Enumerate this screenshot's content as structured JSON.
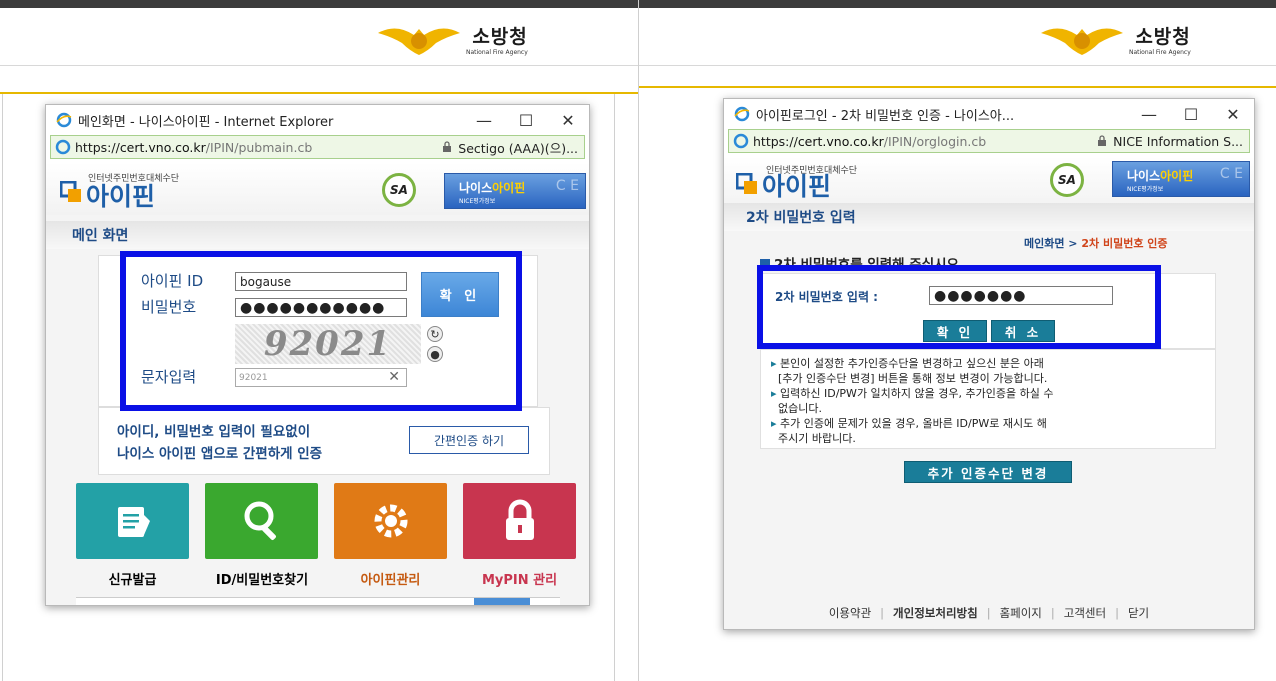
{
  "agency": {
    "name": "소방청",
    "en": "National Fire Agency"
  },
  "left": {
    "window_title": "메인화면 - 나이스아이핀 - Internet Explorer",
    "url_proto": "https://",
    "url_host": "cert.vno.co.kr",
    "url_path": "/IPIN/pubmain.cb",
    "cert": "Sectigo (AAA)(으)...",
    "ipin_small": "인터넷주민번호대체수단",
    "ipin_logo": "아이핀",
    "sa_badge": "SA",
    "nice_box": {
      "a": "나이스",
      "b": "아이핀",
      "sub": "NICE평가정보",
      "ce": "C E"
    },
    "section_title": "메인 화면",
    "id_label": "아이핀 ID",
    "id_value": "bogause",
    "pw_label": "비밀번호",
    "pw_value": "●●●●●●●●●●●",
    "confirm": "확 인",
    "captcha_text": "92021",
    "captcha_label": "문자입력",
    "captcha_value": "92021",
    "promo_line1": "아이디, 비밀번호 입력이 필요없이",
    "promo_line2": "나이스 아이핀 앱으로 간편하게 인증",
    "promo_button": "간편인증 하기",
    "tiles": [
      {
        "label": "신규발급",
        "color": "#23a1a6",
        "label_color": "#1e4b86",
        "icon": "document-icon"
      },
      {
        "label": "ID/비밀번호찾기",
        "color": "#3aa82f",
        "label_color": "#1e4b86",
        "icon": "search-icon"
      },
      {
        "label": "아이핀관리",
        "color": "#e07a16",
        "label_color": "#c55a11",
        "icon": "gear-icon"
      },
      {
        "label": "MyPIN 관리",
        "color": "#c8354f",
        "label_color": "#c8354f",
        "icon": "lock-icon"
      }
    ]
  },
  "right": {
    "window_title": "아이핀로그인 - 2차 비밀번호 인증 - 나이스아...",
    "url_proto": "https://",
    "url_host": "cert.vno.co.kr",
    "url_path": "/IPIN/orglogin.cb",
    "cert": "NICE Information S...",
    "ipin_small": "인터넷주민번호대체수단",
    "ipin_logo": "아이핀",
    "sa_badge": "SA",
    "nice_box": {
      "a": "나이스",
      "b": "아이핀",
      "sub": "NICE평가정보",
      "ce": "C E"
    },
    "section_title": "2차 비밀번호 입력",
    "crumb_home": "메인화면 > ",
    "crumb_current": "2차 비밀번호 인증",
    "instruction": "2차 비밀번호를 입력해 주십시오",
    "pw2_label": "2차 비밀번호 입력 :",
    "pw2_value": "●●●●●●●",
    "confirm": "확 인",
    "cancel": "취 소",
    "notes": [
      "본인이 설정한 추가인증수단을 변경하고 싶으신 분은 아래",
      "[추가 인증수단 변경] 버튼을 통해 정보 변경이 가능합니다.",
      "입력하신 ID/PW가 일치하지 않을 경우, 추가인증을 하실 수",
      "없습니다.",
      "추가 인증에 문제가 있을 경우, 올바른 ID/PW로 재시도 해",
      "주시기 바랍니다."
    ],
    "change_button": "추가 인증수단 변경",
    "footer": [
      "이용약관",
      "개인정보처리방침",
      "홈페이지",
      "고객센터",
      "닫기"
    ]
  }
}
